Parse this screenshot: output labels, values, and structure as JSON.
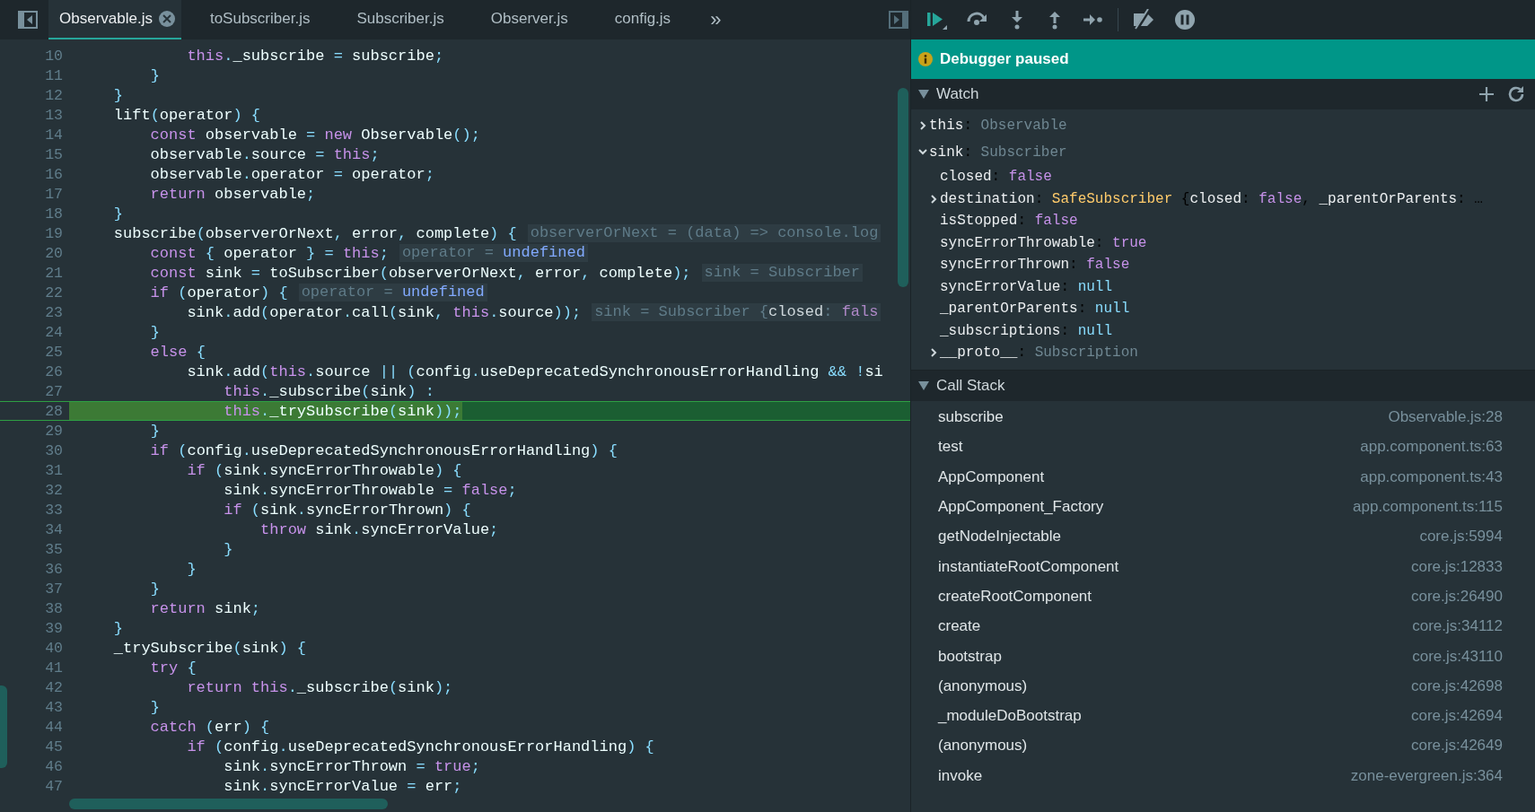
{
  "tabs": [
    {
      "label": "Observable.js",
      "selected": true
    },
    {
      "label": "toSubscriber.js",
      "selected": false
    },
    {
      "label": "Subscriber.js",
      "selected": false
    },
    {
      "label": "Observer.js",
      "selected": false
    },
    {
      "label": "config.js",
      "selected": false
    }
  ],
  "more_tabs": "»",
  "lines": [
    {
      "n": "10",
      "current": false,
      "code": [
        {
          "kind": "keyword",
          "text": "            this"
        },
        {
          "kind": "plain",
          "text": "._subscribe = subscribe;"
        }
      ]
    },
    {
      "n": "11",
      "current": false,
      "code": [
        {
          "kind": "plain",
          "text": "        }"
        }
      ]
    },
    {
      "n": "12",
      "current": false,
      "code": [
        {
          "kind": "plain",
          "text": "    }"
        }
      ]
    },
    {
      "n": "13",
      "current": false,
      "code": [
        {
          "kind": "plain",
          "text": "    lift(operator) {"
        }
      ]
    },
    {
      "n": "14",
      "current": false,
      "code": [
        {
          "kind": "keyword",
          "text": "        const"
        },
        {
          "kind": "plain",
          "text": " observable = "
        },
        {
          "kind": "keyword",
          "text": "new"
        },
        {
          "kind": "plain",
          "text": " Observable();"
        }
      ]
    },
    {
      "n": "15",
      "current": false,
      "code": [
        {
          "kind": "plain",
          "text": "        observable.source = "
        },
        {
          "kind": "keyword",
          "text": "this"
        },
        {
          "kind": "plain",
          "text": ";"
        }
      ]
    },
    {
      "n": "16",
      "current": false,
      "code": [
        {
          "kind": "plain",
          "text": "        observable.operator = operator;"
        }
      ]
    },
    {
      "n": "17",
      "current": false,
      "code": [
        {
          "kind": "keyword",
          "text": "        return"
        },
        {
          "kind": "plain",
          "text": " observable;"
        }
      ]
    },
    {
      "n": "18",
      "current": false,
      "code": [
        {
          "kind": "plain",
          "text": "    }"
        }
      ]
    },
    {
      "n": "19",
      "current": false,
      "code": [
        {
          "kind": "plain",
          "text": "    subscribe(observerOrNext, error, complete) {"
        }
      ],
      "hint": [
        {
          "kind": "hint",
          "text": "observerOrNext = (data) => console.log"
        }
      ]
    },
    {
      "n": "20",
      "current": false,
      "code": [
        {
          "kind": "keyword",
          "text": "        const"
        },
        {
          "kind": "plain",
          "text": " { operator } = "
        },
        {
          "kind": "keyword",
          "text": "this"
        },
        {
          "kind": "plain",
          "text": ";"
        }
      ],
      "hint": [
        {
          "kind": "hint",
          "text": "operator = "
        },
        {
          "kind": "value",
          "text": "undefined"
        }
      ]
    },
    {
      "n": "21",
      "current": false,
      "code": [
        {
          "kind": "keyword",
          "text": "        const"
        },
        {
          "kind": "plain",
          "text": " sink = toSubscriber(observerOrNext, error, complete);"
        }
      ],
      "hint": [
        {
          "kind": "hint",
          "text": "sink = Subscriber"
        }
      ]
    },
    {
      "n": "22",
      "current": false,
      "code": [
        {
          "kind": "keyword",
          "text": "        if"
        },
        {
          "kind": "plain",
          "text": " (operator) {"
        }
      ],
      "hint": [
        {
          "kind": "hint",
          "text": "operator = "
        },
        {
          "kind": "value",
          "text": "undefined"
        }
      ]
    },
    {
      "n": "23",
      "current": false,
      "code": [
        {
          "kind": "plain",
          "text": "            sink.add(operator.call(sink, "
        },
        {
          "kind": "keyword",
          "text": "this"
        },
        {
          "kind": "plain",
          "text": ".source));"
        }
      ],
      "hint": [
        {
          "kind": "hint",
          "text": "sink = Subscriber {"
        },
        {
          "kind": "key",
          "text": "closed"
        },
        {
          "kind": "hint",
          "text": ": "
        },
        {
          "kind": "keyword",
          "text": "fals"
        }
      ]
    },
    {
      "n": "24",
      "current": false,
      "code": [
        {
          "kind": "plain",
          "text": "        }"
        }
      ]
    },
    {
      "n": "25",
      "current": false,
      "code": [
        {
          "kind": "keyword",
          "text": "        else"
        },
        {
          "kind": "plain",
          "text": " {"
        }
      ]
    },
    {
      "n": "26",
      "current": false,
      "code": [
        {
          "kind": "plain",
          "text": "            sink.add("
        },
        {
          "kind": "keyword",
          "text": "this"
        },
        {
          "kind": "plain",
          "text": ".source || (config.useDeprecatedSynchronousErrorHandling && !si"
        }
      ]
    },
    {
      "n": "27",
      "current": false,
      "code": [
        {
          "kind": "keyword",
          "text": "                this"
        },
        {
          "kind": "plain",
          "text": "._subscribe(sink) :"
        }
      ]
    },
    {
      "n": "28",
      "current": true,
      "code": [
        {
          "kind": "keyword",
          "text": "                this"
        },
        {
          "kind": "plain",
          "text": "._trySubscribe(sink));"
        }
      ]
    },
    {
      "n": "29",
      "current": false,
      "code": [
        {
          "kind": "plain",
          "text": "        }"
        }
      ]
    },
    {
      "n": "30",
      "current": false,
      "code": [
        {
          "kind": "keyword",
          "text": "        if"
        },
        {
          "kind": "plain",
          "text": " (config.useDeprecatedSynchronousErrorHandling) {"
        }
      ]
    },
    {
      "n": "31",
      "current": false,
      "code": [
        {
          "kind": "keyword",
          "text": "            if"
        },
        {
          "kind": "plain",
          "text": " (sink.syncErrorThrowable) {"
        }
      ]
    },
    {
      "n": "32",
      "current": false,
      "code": [
        {
          "kind": "plain",
          "text": "                sink.syncErrorThrowable = "
        },
        {
          "kind": "keyword",
          "text": "false"
        },
        {
          "kind": "plain",
          "text": ";"
        }
      ]
    },
    {
      "n": "33",
      "current": false,
      "code": [
        {
          "kind": "keyword",
          "text": "                if"
        },
        {
          "kind": "plain",
          "text": " (sink.syncErrorThrown) {"
        }
      ]
    },
    {
      "n": "34",
      "current": false,
      "code": [
        {
          "kind": "keyword",
          "text": "                    throw"
        },
        {
          "kind": "plain",
          "text": " sink.syncErrorValue;"
        }
      ]
    },
    {
      "n": "35",
      "current": false,
      "code": [
        {
          "kind": "plain",
          "text": "                }"
        }
      ]
    },
    {
      "n": "36",
      "current": false,
      "code": [
        {
          "kind": "plain",
          "text": "            }"
        }
      ]
    },
    {
      "n": "37",
      "current": false,
      "code": [
        {
          "kind": "plain",
          "text": "        }"
        }
      ]
    },
    {
      "n": "38",
      "current": false,
      "code": [
        {
          "kind": "keyword",
          "text": "        return"
        },
        {
          "kind": "plain",
          "text": " sink;"
        }
      ]
    },
    {
      "n": "39",
      "current": false,
      "code": [
        {
          "kind": "plain",
          "text": "    }"
        }
      ]
    },
    {
      "n": "40",
      "current": false,
      "code": [
        {
          "kind": "plain",
          "text": "    _trySubscribe(sink) {"
        }
      ]
    },
    {
      "n": "41",
      "current": false,
      "code": [
        {
          "kind": "keyword",
          "text": "        try"
        },
        {
          "kind": "plain",
          "text": " {"
        }
      ]
    },
    {
      "n": "42",
      "current": false,
      "code": [
        {
          "kind": "keyword",
          "text": "            return this"
        },
        {
          "kind": "plain",
          "text": "._subscribe(sink);"
        }
      ]
    },
    {
      "n": "43",
      "current": false,
      "code": [
        {
          "kind": "plain",
          "text": "        }"
        }
      ]
    },
    {
      "n": "44",
      "current": false,
      "code": [
        {
          "kind": "keyword",
          "text": "        catch"
        },
        {
          "kind": "plain",
          "text": " (err) {"
        }
      ]
    },
    {
      "n": "45",
      "current": false,
      "code": [
        {
          "kind": "keyword",
          "text": "            if"
        },
        {
          "kind": "plain",
          "text": " (config.useDeprecatedSynchronousErrorHandling) {"
        }
      ]
    },
    {
      "n": "46",
      "current": false,
      "code": [
        {
          "kind": "plain",
          "text": "                sink.syncErrorThrown = "
        },
        {
          "kind": "keyword",
          "text": "true"
        },
        {
          "kind": "plain",
          "text": ";"
        }
      ]
    },
    {
      "n": "47",
      "current": false,
      "code": [
        {
          "kind": "plain",
          "text": "                sink.syncErrorValue = err;"
        }
      ]
    }
  ],
  "banner": "Debugger paused",
  "watch": {
    "title": "Watch",
    "items": [
      {
        "kind": "object",
        "expanded": false,
        "text": [
          {
            "kind": "name",
            "text": "this"
          },
          {
            "kind": "punct",
            "text": ": "
          },
          {
            "kind": "type",
            "text": "Observable"
          }
        ]
      },
      {
        "kind": "object",
        "expanded": true,
        "text": [
          {
            "kind": "name",
            "text": "sink"
          },
          {
            "kind": "punct",
            "text": ": "
          },
          {
            "kind": "type",
            "text": "Subscriber"
          }
        ],
        "children": [
          {
            "kind": "value",
            "text": [
              {
                "kind": "name",
                "text": "closed"
              },
              {
                "kind": "punct",
                "text": ": "
              },
              {
                "kind": "bool",
                "text": "false"
              }
            ]
          },
          {
            "kind": "object",
            "expanded": false,
            "text": [
              {
                "kind": "name",
                "text": "destination"
              },
              {
                "kind": "punct",
                "text": ": "
              },
              {
                "kind": "class",
                "text": "SafeSubscriber"
              },
              {
                "kind": "punct",
                "text": " {"
              },
              {
                "kind": "name",
                "text": "closed"
              },
              {
                "kind": "punct",
                "text": ": "
              },
              {
                "kind": "bool",
                "text": "false"
              },
              {
                "kind": "punct",
                "text": ", "
              },
              {
                "kind": "name",
                "text": "_parentOrParents"
              },
              {
                "kind": "punct",
                "text": ": …"
              }
            ]
          },
          {
            "kind": "value",
            "text": [
              {
                "kind": "name",
                "text": "isStopped"
              },
              {
                "kind": "punct",
                "text": ": "
              },
              {
                "kind": "bool",
                "text": "false"
              }
            ]
          },
          {
            "kind": "value",
            "text": [
              {
                "kind": "name",
                "text": "syncErrorThrowable"
              },
              {
                "kind": "punct",
                "text": ": "
              },
              {
                "kind": "bool",
                "text": "true"
              }
            ]
          },
          {
            "kind": "value",
            "text": [
              {
                "kind": "name",
                "text": "syncErrorThrown"
              },
              {
                "kind": "punct",
                "text": ": "
              },
              {
                "kind": "bool",
                "text": "false"
              }
            ]
          },
          {
            "kind": "value",
            "text": [
              {
                "kind": "name",
                "text": "syncErrorValue"
              },
              {
                "kind": "punct",
                "text": ": "
              },
              {
                "kind": "null",
                "text": "null"
              }
            ]
          },
          {
            "kind": "value",
            "text": [
              {
                "kind": "name",
                "text": "_parentOrParents"
              },
              {
                "kind": "punct",
                "text": ": "
              },
              {
                "kind": "null",
                "text": "null"
              }
            ]
          },
          {
            "kind": "value",
            "text": [
              {
                "kind": "name",
                "text": "_subscriptions"
              },
              {
                "kind": "punct",
                "text": ": "
              },
              {
                "kind": "null",
                "text": "null"
              }
            ]
          },
          {
            "kind": "object",
            "expanded": false,
            "text": [
              {
                "kind": "name",
                "text": "__proto__"
              },
              {
                "kind": "punct",
                "text": ": "
              },
              {
                "kind": "type",
                "text": "Subscription"
              }
            ]
          }
        ]
      }
    ]
  },
  "call_stack": {
    "title": "Call Stack",
    "frames": [
      {
        "name": "subscribe",
        "location": "Observable.js:28"
      },
      {
        "name": "test",
        "location": "app.component.ts:63"
      },
      {
        "name": "AppComponent",
        "location": "app.component.ts:43"
      },
      {
        "name": "AppComponent_Factory",
        "location": "app.component.ts:115"
      },
      {
        "name": "getNodeInjectable",
        "location": "core.js:5994"
      },
      {
        "name": "instantiateRootComponent",
        "location": "core.js:12833"
      },
      {
        "name": "createRootComponent",
        "location": "core.js:26490"
      },
      {
        "name": "create",
        "location": "core.js:34112"
      },
      {
        "name": "bootstrap",
        "location": "core.js:43110"
      },
      {
        "name": "(anonymous)",
        "location": "core.js:42698"
      },
      {
        "name": "_moduleDoBootstrap",
        "location": "core.js:42694"
      },
      {
        "name": "(anonymous)",
        "location": "core.js:42649"
      },
      {
        "name": "invoke",
        "location": "zone-evergreen.js:364"
      }
    ]
  }
}
